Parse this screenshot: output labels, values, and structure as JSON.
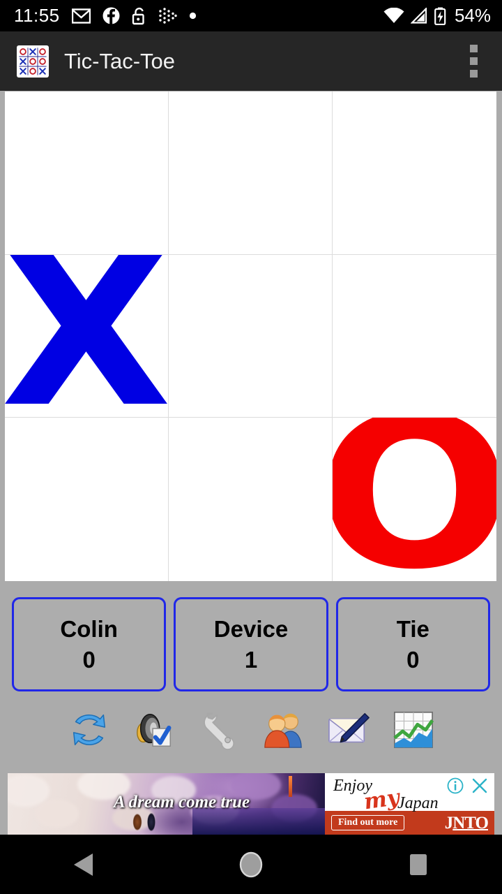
{
  "status_bar": {
    "time": "11:55",
    "battery_percent": "54%",
    "icons": [
      "gmail-icon",
      "facebook-icon",
      "unlocked-padlock-icon",
      "fitbit-icon",
      "dot-icon"
    ],
    "right_icons": [
      "wifi-icon",
      "cellular-signal-icon",
      "battery-charging-icon"
    ]
  },
  "app_bar": {
    "title": "Tic-Tac-Toe",
    "icon_name": "tic-tac-toe-app-icon",
    "overflow_label": "more-options"
  },
  "board": {
    "cells": [
      {
        "id": "cell-0",
        "mark": "",
        "pos": "top-left"
      },
      {
        "id": "cell-1",
        "mark": "",
        "pos": "top-center"
      },
      {
        "id": "cell-2",
        "mark": "",
        "pos": "top-right"
      },
      {
        "id": "cell-3",
        "mark": "X",
        "pos": "middle-left"
      },
      {
        "id": "cell-4",
        "mark": "",
        "pos": "middle-center"
      },
      {
        "id": "cell-5",
        "mark": "",
        "pos": "middle-right"
      },
      {
        "id": "cell-6",
        "mark": "",
        "pos": "bottom-left"
      },
      {
        "id": "cell-7",
        "mark": "",
        "pos": "bottom-center"
      },
      {
        "id": "cell-8",
        "mark": "O",
        "pos": "bottom-right"
      }
    ],
    "x_color": "#0000E3",
    "o_color": "#F50000",
    "grid_line_color": "#DCDCDC",
    "cell_background": "#FFFFFF"
  },
  "scores": {
    "border_color": "#2027E8",
    "cards": [
      {
        "name": "Colin",
        "value": "0"
      },
      {
        "name": "Device",
        "value": "1"
      },
      {
        "name": "Tie",
        "value": "0"
      }
    ]
  },
  "toolbar": {
    "icons": [
      "restart-icon",
      "sound-settings-icon",
      "wrench-settings-icon",
      "two-people-icon",
      "envelope-pen-icon",
      "statistics-chart-icon"
    ]
  },
  "ad": {
    "tagline": "A dream come true",
    "brand_line1": "Enjoy",
    "brand_script": "my",
    "brand_line2": "Japan",
    "cta": "Find out more",
    "logo": "JNTO",
    "info_icon": "ad-info-icon",
    "close_icon": "ad-close-icon",
    "cta_bar_color": "#C23A1C"
  },
  "nav_bar": {
    "back": "back-button",
    "home": "home-button",
    "recents": "recents-button"
  },
  "theme": {
    "background": "#ABABAB",
    "app_bar": "#262626",
    "status_bar": "#000000"
  }
}
